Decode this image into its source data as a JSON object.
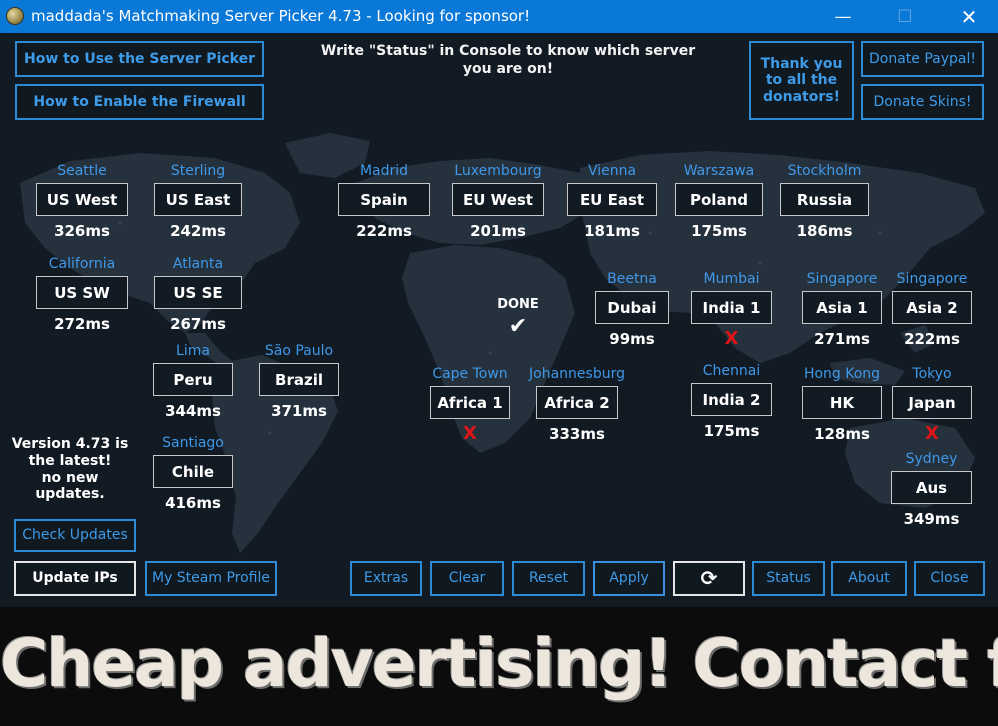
{
  "window": {
    "title": "maddada's Matchmaking Server Picker 4.73 - Looking for sponsor!",
    "minimize_glyph": "—",
    "maximize_glyph": "☐",
    "close_glyph": "✕"
  },
  "top_buttons": {
    "how_to_use": "How to Use the Server Picker",
    "enable_firewall": "How to Enable the Firewall",
    "thank_you_line1": "Thank you",
    "thank_you_line2": "to all the",
    "thank_you_line3": "donators!",
    "donate_paypal": "Donate Paypal!",
    "donate_skins": "Donate Skins!"
  },
  "console_note": {
    "line1": "Write \"Status\" in Console to know which server",
    "line2": "you are on!"
  },
  "servers": [
    {
      "city": "Seattle",
      "name": "US West",
      "ping": "326ms"
    },
    {
      "city": "Sterling",
      "name": "US East",
      "ping": "242ms"
    },
    {
      "city": "Madrid",
      "name": "Spain",
      "ping": "222ms"
    },
    {
      "city": "Luxembourg",
      "name": "EU West",
      "ping": "201ms"
    },
    {
      "city": "Vienna",
      "name": "EU East",
      "ping": "181ms"
    },
    {
      "city": "Warszawa",
      "name": "Poland",
      "ping": "175ms"
    },
    {
      "city": "Stockholm",
      "name": "Russia",
      "ping": "186ms"
    },
    {
      "city": "California",
      "name": "US SW",
      "ping": "272ms"
    },
    {
      "city": "Atlanta",
      "name": "US SE",
      "ping": "267ms"
    },
    {
      "city": "Beetna",
      "name": "Dubai",
      "ping": "99ms"
    },
    {
      "city": "Mumbai",
      "name": "India 1",
      "ping": "X"
    },
    {
      "city": "Singapore",
      "name": "Asia 1",
      "ping": "271ms"
    },
    {
      "city": "Singapore",
      "name": "Asia 2",
      "ping": "222ms"
    },
    {
      "city": "Lima",
      "name": "Peru",
      "ping": "344ms"
    },
    {
      "city": "São Paulo",
      "name": "Brazil",
      "ping": "371ms"
    },
    {
      "city": "Cape Town",
      "name": "Africa 1",
      "ping": "X"
    },
    {
      "city": "Johannesburg",
      "name": "Africa 2",
      "ping": "333ms"
    },
    {
      "city": "Chennai",
      "name": "India 2",
      "ping": "175ms"
    },
    {
      "city": "Hong Kong",
      "name": "HK",
      "ping": "128ms"
    },
    {
      "city": "Tokyo",
      "name": "Japan",
      "ping": "X"
    },
    {
      "city": "Santiago",
      "name": "Chile",
      "ping": "416ms"
    },
    {
      "city": "Sydney",
      "name": "Aus",
      "ping": "349ms"
    }
  ],
  "done": {
    "label": "DONE",
    "check": "✔"
  },
  "version": {
    "line1": "Version 4.73 is",
    "line2": "the latest!",
    "line3": "no new",
    "line4": "updates."
  },
  "bottom_buttons": {
    "check_updates": "Check Updates",
    "update_ips": "Update IPs",
    "steam_profile": "My Steam Profile",
    "extras": "Extras",
    "clear": "Clear",
    "reset": "Reset",
    "apply": "Apply",
    "refresh_glyph": "⟳",
    "status": "Status",
    "about": "About",
    "close": "Close"
  },
  "ad_banner": "Cheap advertising! Contact for details :D",
  "colors": {
    "titlebar": "#0a78d7",
    "accent_blue": "#2d8bd6",
    "background": "#121a23",
    "fail_red": "#e01414"
  },
  "icons": {
    "app": "coin-icon",
    "refresh": "refresh-icon",
    "check": "checkmark-icon",
    "fail": "red-x-icon"
  }
}
